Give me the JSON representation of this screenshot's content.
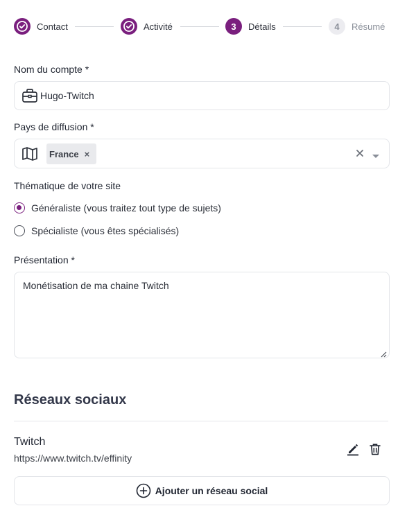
{
  "stepper": {
    "steps": [
      {
        "label": "Contact",
        "state": "done"
      },
      {
        "label": "Activité",
        "state": "done"
      },
      {
        "number": "3",
        "label": "Détails",
        "state": "active"
      },
      {
        "number": "4",
        "label": "Résumé",
        "state": "pending"
      }
    ]
  },
  "account": {
    "label": "Nom du compte *",
    "value": "Hugo-Twitch",
    "icon": "briefcase-icon"
  },
  "country": {
    "label": "Pays de diffusion *",
    "icon": "map-icon",
    "selected": "France",
    "remove_glyph": "×"
  },
  "theme": {
    "label": "Thématique de votre site",
    "options": [
      {
        "label": "Généraliste (vous traitez tout type de sujets)",
        "checked": true
      },
      {
        "label": "Spécialiste (vous êtes spécialisés)",
        "checked": false
      }
    ]
  },
  "presentation": {
    "label": "Présentation *",
    "value": "Monétisation de ma chaine Twitch"
  },
  "social": {
    "title": "Réseaux sociaux",
    "items": [
      {
        "name": "Twitch",
        "url": "https://www.twitch.tv/effinity"
      }
    ],
    "add_label": "Ajouter un réseau social"
  },
  "colors": {
    "accent": "#7a1f7e",
    "pending": "#ececf0"
  }
}
